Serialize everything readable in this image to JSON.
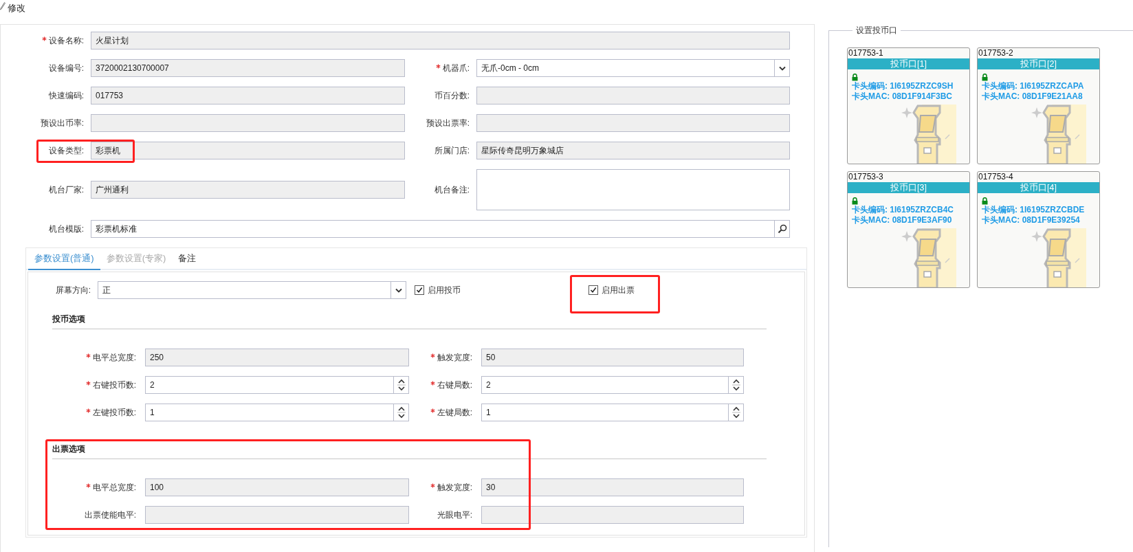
{
  "title": "修改",
  "form": {
    "rows": [
      {
        "fields": [
          {
            "label": "设备名称:",
            "required": true,
            "kind": "readonly",
            "value": "火星计划",
            "wide": true
          }
        ]
      },
      {
        "fields": [
          {
            "label": "设备编号:",
            "required": false,
            "kind": "readonly",
            "value": "3720002130700007"
          },
          {
            "label": "机器爪:",
            "required": true,
            "kind": "select",
            "value": "无爪-0cm - 0cm"
          }
        ]
      },
      {
        "fields": [
          {
            "label": "快速编码:",
            "required": false,
            "kind": "readonly",
            "value": "017753"
          },
          {
            "label": "币百分数:",
            "required": false,
            "kind": "readonly"
          }
        ]
      },
      {
        "fields": [
          {
            "label": "预设出币率:",
            "required": false,
            "kind": "readonly"
          },
          {
            "label": "预设出票率:",
            "required": false,
            "kind": "readonly"
          }
        ]
      },
      {
        "fields": [
          {
            "label": "设备类型:",
            "required": false,
            "kind": "readonly",
            "value": "彩票机",
            "highlighted": true
          },
          {
            "label": "所属门店:",
            "required": false,
            "kind": "readonly",
            "value": "星际传奇昆明万象城店"
          }
        ]
      },
      {
        "fields": [
          {
            "label": "机台厂家:",
            "required": false,
            "kind": "readonly",
            "value": "广州通利"
          },
          {
            "label": "机台备注:",
            "required": false,
            "kind": "textarea"
          }
        ]
      },
      {
        "fields": [
          {
            "label": "机台模版:",
            "required": false,
            "kind": "search",
            "value": "彩票机标准",
            "wide": true
          }
        ]
      }
    ]
  },
  "tabs": [
    {
      "label": "参数设置(普通)",
      "selected": true,
      "disabled": false
    },
    {
      "label": "参数设置(专家)",
      "selected": false,
      "disabled": true
    },
    {
      "label": "备注",
      "selected": false,
      "disabled": false
    }
  ],
  "settings": {
    "screen": {
      "label": "屏幕方向:",
      "value": "正"
    },
    "checkboxes": [
      {
        "label": "启用投币",
        "checked": true,
        "highlighted": false
      },
      {
        "label": "启用出票",
        "checked": true,
        "highlighted": true
      }
    ],
    "sections": [
      {
        "title": "投币选项",
        "highlighted": false,
        "rows": [
          [
            {
              "label": "电平总宽度:",
              "required": true,
              "kind": "readonly",
              "value": "250"
            },
            {
              "label": "触发宽度:",
              "required": true,
              "kind": "readonly",
              "value": "50"
            }
          ],
          [
            {
              "label": "右键投币数:",
              "required": true,
              "kind": "spinner",
              "value": "2"
            },
            {
              "label": "右键局数:",
              "required": true,
              "kind": "spinner",
              "value": "2"
            }
          ],
          [
            {
              "label": "左键投币数:",
              "required": true,
              "kind": "spinner",
              "value": "1"
            },
            {
              "label": "左键局数:",
              "required": true,
              "kind": "spinner",
              "value": "1"
            }
          ]
        ]
      },
      {
        "title": "出票选项",
        "highlighted": true,
        "rows": [
          [
            {
              "label": "电平总宽度:",
              "required": true,
              "kind": "readonly",
              "value": "100"
            },
            {
              "label": "触发宽度:",
              "required": true,
              "kind": "readonly",
              "value": "30"
            }
          ],
          [
            {
              "label": "出票使能电平:",
              "required": false,
              "kind": "readonly"
            },
            {
              "label": "光眼电平:",
              "required": false,
              "kind": "readonly"
            }
          ]
        ]
      }
    ]
  },
  "ports": {
    "legend": "设置投币口",
    "items": [
      {
        "id": "017753-1",
        "name": "投币口[1]",
        "locked": true,
        "lines": [
          "卡头编码: 1I6195ZRZC9SH",
          "卡头MAC: 08D1F914F3BC"
        ]
      },
      {
        "id": "017753-2",
        "name": "投币口[2]",
        "locked": true,
        "lines": [
          "卡头编码: 1I6195ZRZCAPA",
          "卡头MAC: 08D1F9E21AA8"
        ]
      },
      {
        "id": "017753-3",
        "name": "投币口[3]",
        "locked": true,
        "lines": [
          "卡头编码: 1I6195ZRZCB4C",
          "卡头MAC: 08D1F9E3AF90"
        ]
      },
      {
        "id": "017753-4",
        "name": "投币口[4]",
        "locked": true,
        "lines": [
          "卡头编码: 1I6195ZRZCBDE",
          "卡头MAC: 08D1F9E39254"
        ]
      }
    ]
  }
}
